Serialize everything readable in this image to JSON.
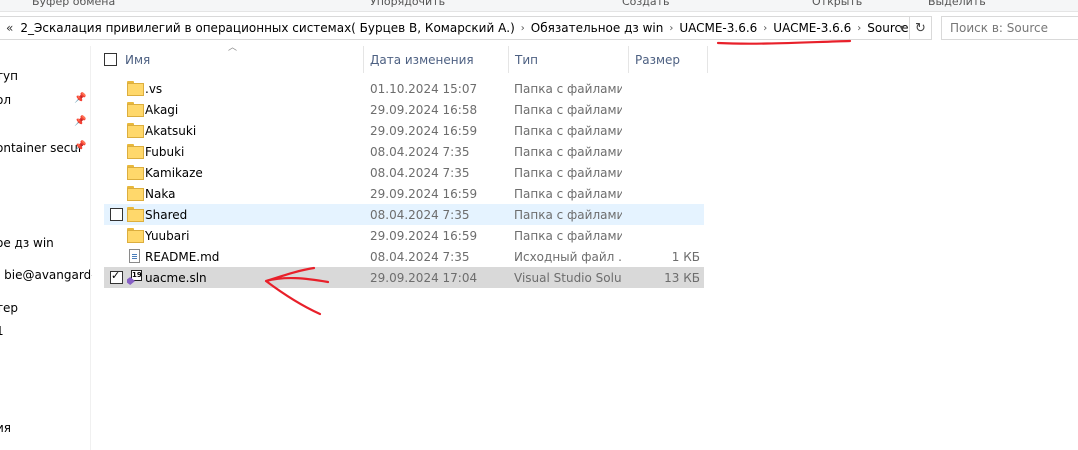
{
  "ribbon": {
    "clipboard": "Буфер обмена",
    "organize": "Упорядочить",
    "new": "Создать",
    "open": "Открыть",
    "select": "Выделить"
  },
  "address": {
    "overflow": "«",
    "crumbs": [
      "2_Эскалация привилегий в операционных системах( Бурцев В, Комарский А.)",
      "Обязательное дз win",
      "UACME-3.6.6",
      "UACME-3.6.6",
      "Source"
    ],
    "search_placeholder": "Поиск в: Source"
  },
  "nav": {
    "items": [
      {
        "label": "туп",
        "pinned": false
      },
      {
        "label": "ол",
        "pinned": true
      },
      {
        "label": "",
        "pinned": true
      },
      {
        "label": "ontainer secur",
        "pinned": true
      },
      {
        "label": "ое дз win",
        "pinned": false
      },
      {
        "label": "- bie@avangard-",
        "pinned": false
      },
      {
        "label": "тер",
        "pinned": false
      },
      {
        "label": "1",
        "pinned": false
      },
      {
        "label": "ия",
        "pinned": false
      }
    ]
  },
  "columns": {
    "name": "Имя",
    "date": "Дата изменения",
    "type": "Тип",
    "size": "Размер"
  },
  "files": [
    {
      "name": ".vs",
      "date": "01.10.2024 15:07",
      "type": "Папка с файлами",
      "size": "",
      "kind": "folder"
    },
    {
      "name": "Akagi",
      "date": "29.09.2024 16:58",
      "type": "Папка с файлами",
      "size": "",
      "kind": "folder"
    },
    {
      "name": "Akatsuki",
      "date": "29.09.2024 16:59",
      "type": "Папка с файлами",
      "size": "",
      "kind": "folder"
    },
    {
      "name": "Fubuki",
      "date": "08.04.2024 7:35",
      "type": "Папка с файлами",
      "size": "",
      "kind": "folder"
    },
    {
      "name": "Kamikaze",
      "date": "08.04.2024 7:35",
      "type": "Папка с файлами",
      "size": "",
      "kind": "folder"
    },
    {
      "name": "Naka",
      "date": "29.09.2024 16:59",
      "type": "Папка с файлами",
      "size": "",
      "kind": "folder"
    },
    {
      "name": "Shared",
      "date": "08.04.2024 7:35",
      "type": "Папка с файлами",
      "size": "",
      "kind": "folder"
    },
    {
      "name": "Yuubari",
      "date": "29.09.2024 16:59",
      "type": "Папка с файлами",
      "size": "",
      "kind": "folder"
    },
    {
      "name": "README.md",
      "date": "08.04.2024 7:35",
      "type": "Исходный файл ...",
      "size": "1 КБ",
      "kind": "md"
    },
    {
      "name": "uacme.sln",
      "date": "29.09.2024 17:04",
      "type": "Visual Studio Solu...",
      "size": "13 КБ",
      "kind": "sln"
    }
  ],
  "colors": {
    "hover_row": "#e5f3ff",
    "selected_row": "#d9d9d9",
    "header_text": "#4d6082",
    "annotation_red": "#e8202a"
  },
  "icons": {
    "folder": "folder-icon",
    "markdown": "markdown-file-icon",
    "solution": "visual-studio-solution-icon",
    "pin": "pin-icon",
    "refresh": "refresh-icon",
    "dropdown": "chevron-down-icon"
  }
}
